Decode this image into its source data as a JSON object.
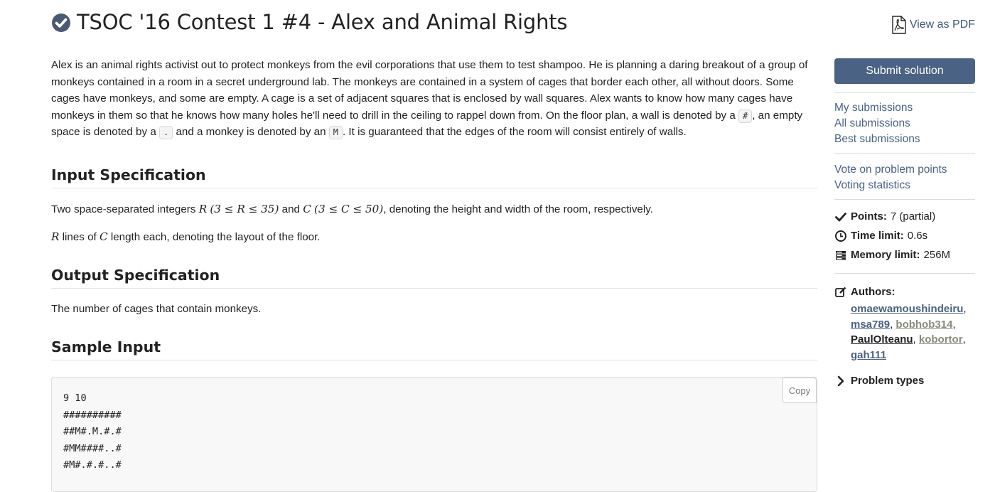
{
  "header": {
    "title": "TSOC '16 Contest 1 #4 - Alex and Animal Rights",
    "pdf_label": "View as PDF"
  },
  "statement": {
    "intro": [
      "Alex is an animal rights activist out to protect monkeys from the evil corporations that use them to test shampoo. He is planning a daring breakout of a group of monkeys contained in a room in a secret underground lab. The monkeys are contained in a system of cages that border each other, all without doors. Some cages have monkeys, and some are empty. A cage is a set of adjacent squares that is enclosed by wall squares. Alex wants to know how many cages have monkeys in them so that he knows how many holes he'll need to drill in the ceiling to rappel down from. On the floor plan, a wall is denoted by a ",
      ", an empty space is denoted by a ",
      " and a monkey is denoted by an ",
      ". It is guaranteed that the edges of the room will consist entirely of walls."
    ],
    "codes": [
      "#",
      ".",
      "M"
    ]
  },
  "input_spec": {
    "heading": "Input Specification",
    "line1_prefix": "Two space-separated integers ",
    "var_r": "R",
    "var_c": "C",
    "r_range": "(3 ≤ R ≤ 35)",
    "and": " and ",
    "c_range": "(3 ≤ C ≤ 50)",
    "line1_suffix": ", denoting the height and width of the room, respectively.",
    "line2_mid1": " lines of ",
    "line2_suffix": " length each, denoting the layout of the floor."
  },
  "output_spec": {
    "heading": "Output Specification",
    "text": "The number of cages that contain monkeys."
  },
  "sample_input": {
    "heading": "Sample Input",
    "lines": [
      "9 10",
      "##########",
      "##M#.M.#.#",
      "#MM####..#",
      "#M#.#.#..#"
    ],
    "copy_label": "Copy"
  },
  "sidebar": {
    "submit_label": "Submit solution",
    "links_group1": [
      "My submissions",
      "All submissions",
      "Best submissions"
    ],
    "links_group2": [
      "Vote on problem points",
      "Voting statistics"
    ],
    "points_label": "Points:",
    "points_value": "7 (partial)",
    "time_label": "Time limit:",
    "time_value": "0.6s",
    "memory_label": "Memory limit:",
    "memory_value": "256M",
    "authors_label": "Authors:",
    "authors": [
      "omaewamoushindeiru",
      "msa789",
      "bobhob314",
      "PaulOlteanu",
      "kobortor",
      "gah111"
    ],
    "problem_types_label": "Problem types"
  },
  "colors": {
    "link": "#4a6283",
    "submit_bg": "#4a6283",
    "title_icon": "#4a5a75"
  }
}
